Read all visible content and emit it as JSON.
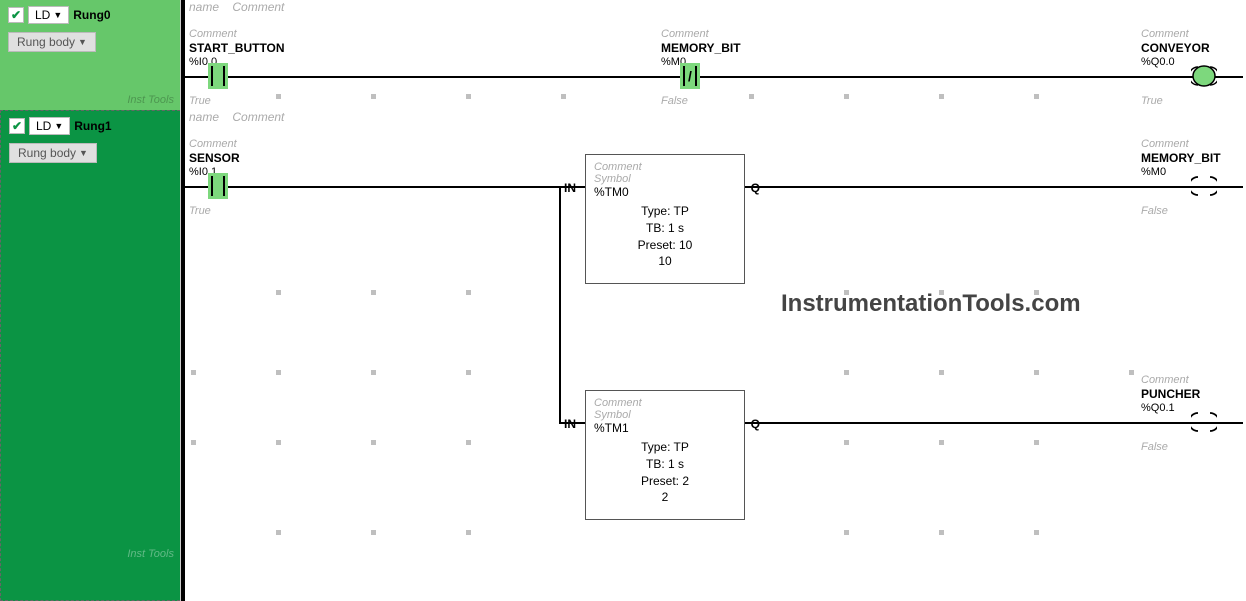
{
  "rung0": {
    "ld": "LD",
    "name": "Rung0",
    "rung_body": "Rung body",
    "inst_tools": "Inst Tools",
    "header_name": "name",
    "header_comment": "Comment",
    "contact1": {
      "comment": "Comment",
      "symbol": "START_BUTTON",
      "addr": "%I0.0",
      "state": "True"
    },
    "contact2": {
      "comment": "Comment",
      "symbol": "MEMORY_BIT",
      "addr": "%M0",
      "state": "False"
    },
    "coil": {
      "comment": "Comment",
      "symbol": "CONVEYOR",
      "addr": "%Q0.0",
      "state": "True"
    }
  },
  "rung1": {
    "ld": "LD",
    "name": "Rung1",
    "rung_body": "Rung body",
    "inst_tools": "Inst Tools",
    "header_name": "name",
    "header_comment": "Comment",
    "contact1": {
      "comment": "Comment",
      "symbol": "SENSOR",
      "addr": "%I0.1",
      "state": "True"
    },
    "timer1": {
      "pin_in": "IN",
      "pin_q": "Q",
      "comment": "Comment",
      "symbol": "Symbol",
      "addr": "%TM0",
      "type": "Type: TP",
      "tb": "TB: 1 s",
      "preset": "Preset: 10",
      "value": "10"
    },
    "timer2": {
      "pin_in": "IN",
      "pin_q": "Q",
      "comment": "Comment",
      "symbol": "Symbol",
      "addr": "%TM1",
      "type": "Type: TP",
      "tb": "TB: 1 s",
      "preset": "Preset: 2",
      "value": "2"
    },
    "coil1": {
      "comment": "Comment",
      "symbol": "MEMORY_BIT",
      "addr": "%M0",
      "state": "False"
    },
    "coil2": {
      "comment": "Comment",
      "symbol": "PUNCHER",
      "addr": "%Q0.1",
      "state": "False"
    },
    "watermark": "InstrumentationTools.com"
  }
}
